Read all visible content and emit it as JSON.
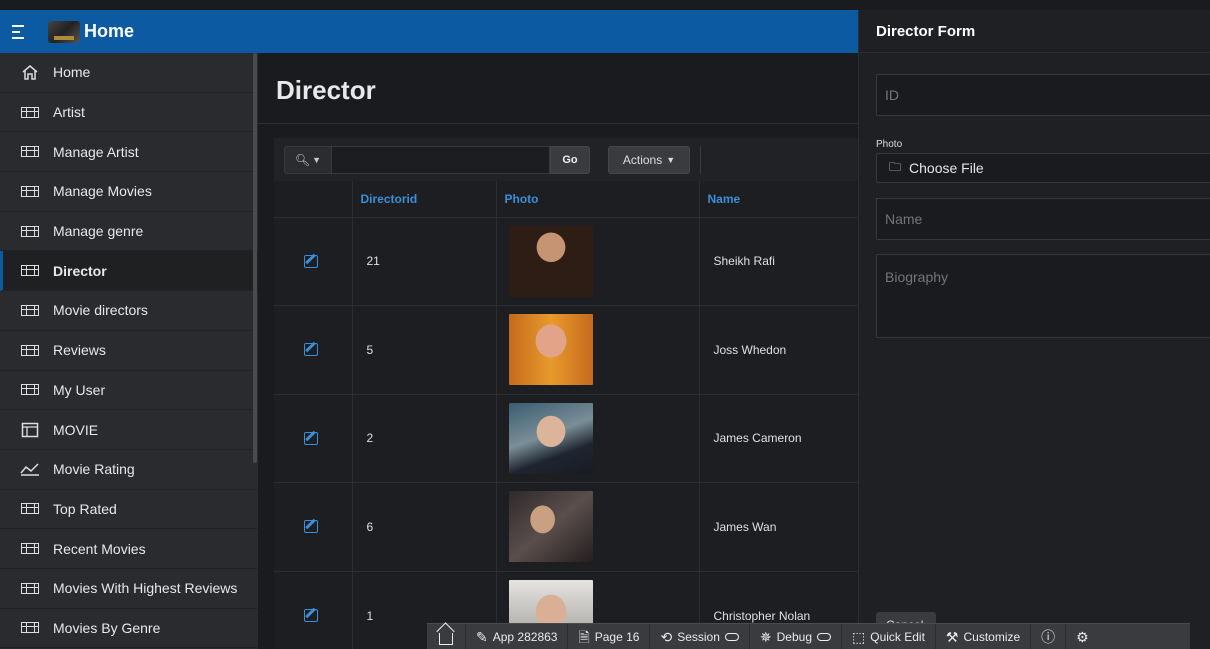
{
  "header": {
    "app_title": "Home"
  },
  "sidebar": {
    "items": [
      {
        "label": "Home",
        "icon": "home-icon"
      },
      {
        "label": "Artist",
        "icon": "grid-icon"
      },
      {
        "label": "Manage Artist",
        "icon": "grid-icon"
      },
      {
        "label": "Manage Movies",
        "icon": "grid-icon"
      },
      {
        "label": "Manage genre",
        "icon": "grid-icon"
      },
      {
        "label": "Director",
        "icon": "grid-icon",
        "active": true
      },
      {
        "label": "Movie directors",
        "icon": "grid-icon"
      },
      {
        "label": "Reviews",
        "icon": "grid-icon"
      },
      {
        "label": "My User",
        "icon": "grid-icon"
      },
      {
        "label": "MOVIE",
        "icon": "window-icon"
      },
      {
        "label": "Movie Rating",
        "icon": "line-chart-icon"
      },
      {
        "label": "Top Rated",
        "icon": "grid-icon"
      },
      {
        "label": "Recent Movies",
        "icon": "grid-icon"
      },
      {
        "label": "Movies With Highest Reviews",
        "icon": "grid-icon"
      },
      {
        "label": "Movies By Genre",
        "icon": "grid-icon"
      }
    ]
  },
  "main": {
    "title": "Director",
    "toolbar": {
      "go_label": "Go",
      "actions_label": "Actions",
      "search_value": ""
    },
    "columns": [
      "",
      "Directorid",
      "Photo",
      "Name"
    ],
    "rows": [
      {
        "id": "21",
        "name": "Sheikh Rafi"
      },
      {
        "id": "5",
        "name": "Joss Whedon"
      },
      {
        "id": "2",
        "name": "James Cameron"
      },
      {
        "id": "6",
        "name": "James Wan"
      },
      {
        "id": "1",
        "name": "Christopher Nolan"
      }
    ]
  },
  "drawer": {
    "title": "Director Form",
    "id_placeholder": "ID",
    "photo_label": "Photo",
    "choose_file": "Choose File",
    "name_placeholder": "Name",
    "biography_placeholder": "Biography",
    "cancel_label": "Cancel"
  },
  "devbar": {
    "app": "App 282863",
    "page": "Page 16",
    "session": "Session",
    "debug": "Debug",
    "quick_edit": "Quick Edit",
    "customize": "Customize"
  },
  "colors": {
    "header_blue": "#0b5aa2",
    "link_blue": "#3b8ed9",
    "required_red": "#e02020"
  }
}
